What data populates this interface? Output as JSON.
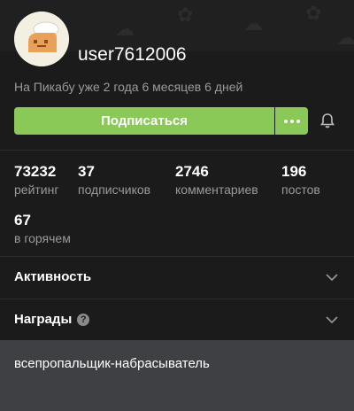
{
  "profile": {
    "username": "user7612006",
    "since": "На Пикабу уже 2 года 6 месяцев 6 дней"
  },
  "actions": {
    "subscribe_label": "Подписаться"
  },
  "stats": [
    {
      "value": "73232",
      "label": "рейтинг"
    },
    {
      "value": "37",
      "label": "подписчиков"
    },
    {
      "value": "2746",
      "label": "комментариев"
    },
    {
      "value": "196",
      "label": "постов"
    },
    {
      "value": "67",
      "label": "в горячем"
    }
  ],
  "sections": {
    "activity": "Активность",
    "awards": "Награды",
    "awards_help": "?"
  },
  "awards": {
    "item": "всепропальщик-набрасыватель"
  },
  "colors": {
    "accent": "#8ac858",
    "background": "#1b1b1b",
    "panel": "#3e4043",
    "muted": "#9a9a9a"
  }
}
